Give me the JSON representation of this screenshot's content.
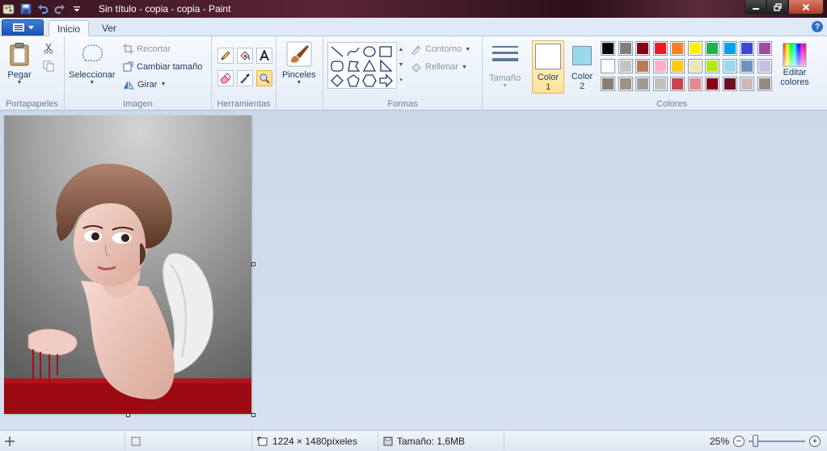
{
  "window": {
    "title": "Sin título - copia - copia - Paint"
  },
  "tabs": [
    {
      "label": "Inicio",
      "active": true
    },
    {
      "label": "Ver",
      "active": false
    }
  ],
  "ribbon": {
    "clipboard": {
      "label": "Portapapeles",
      "paste": "Pegar"
    },
    "image": {
      "label": "Imagen",
      "select": "Seleccionar",
      "crop": "Recortar",
      "resize": "Cambiar tamaño",
      "rotate": "Girar"
    },
    "tools": {
      "label": "Herramientas"
    },
    "brushes": {
      "label": "Pinceles"
    },
    "shapes": {
      "label": "Formas",
      "outline": "Contorno",
      "fill": "Rellenar"
    },
    "size": {
      "label": "Tamaño"
    },
    "colors": {
      "label": "Colores",
      "color1": "Color",
      "color1_num": "1",
      "color2": "Color",
      "color2_num": "2",
      "edit": "Editar",
      "edit2": "colores",
      "color1_value": "#ffffff",
      "color2_value": "#99d9ea",
      "palette": [
        [
          "#000000",
          "#7f7f7f",
          "#880015",
          "#ed1c24",
          "#ff7f27",
          "#fff200",
          "#22b14c",
          "#00a2e8",
          "#3f48cc",
          "#a349a4"
        ],
        [
          "#ffffff",
          "#c3c3c3",
          "#b97a57",
          "#ffaec9",
          "#ffc90e",
          "#efe4b0",
          "#b5e61d",
          "#99d9ea",
          "#7092be",
          "#c8bfe7"
        ],
        [
          "#8c7d70",
          "#9e9186",
          "#a09c93",
          "#c3c0bc",
          "#c9454f",
          "#e08a8f",
          "#8b0018",
          "#6d1020",
          "#cdb9b3",
          "#968a82"
        ]
      ]
    }
  },
  "status": {
    "dimensions": "1224 × 1480píxeles",
    "filesize": "Tamaño: 1,6MB",
    "zoom": "25%",
    "zoom_level": 0.25
  }
}
